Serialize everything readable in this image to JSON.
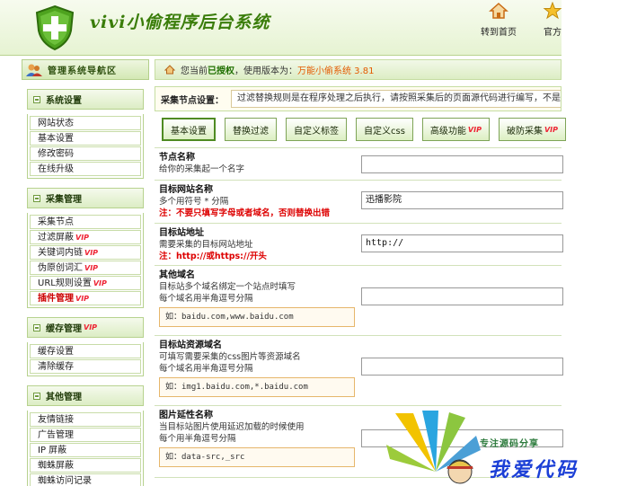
{
  "header": {
    "title": "vivi小偷程序后台系统",
    "nav": [
      {
        "label": "转到首页",
        "icon": "home-icon"
      },
      {
        "label": "官方",
        "icon": "star-icon"
      }
    ]
  },
  "breadcrumb": {
    "prefix": "您当前",
    "authorized": "已授权",
    "mid": "，使用版本为：",
    "version": "万能小偷系统 3.81"
  },
  "sidebar": {
    "title": "管理系统导航区",
    "groups": [
      {
        "title": "系统设置",
        "items": [
          {
            "label": "网站状态"
          },
          {
            "label": "基本设置"
          },
          {
            "label": "修改密码"
          },
          {
            "label": "在线升级"
          }
        ]
      },
      {
        "title": "采集管理",
        "items": [
          {
            "label": "采集节点"
          },
          {
            "label": "过滤屏蔽",
            "vip": "VIP"
          },
          {
            "label": "关键词内链",
            "vip": "VIP"
          },
          {
            "label": "伪原创词汇",
            "vip": "VIP"
          },
          {
            "label": "URL规则设置",
            "vip": "VIP"
          },
          {
            "label": "插件管理",
            "vip": "VIP"
          }
        ]
      },
      {
        "title": "缓存管理",
        "vip": "VIP",
        "items": [
          {
            "label": "缓存设置"
          },
          {
            "label": "清除缓存"
          }
        ]
      },
      {
        "title": "其他管理",
        "items": [
          {
            "label": "友情链接"
          },
          {
            "label": "广告管理"
          },
          {
            "label": "IP 屏蔽"
          },
          {
            "label": "蜘蛛屏蔽"
          },
          {
            "label": "蜘蛛访问记录"
          }
        ]
      }
    ]
  },
  "settings": {
    "label": "采集节点设置：",
    "note": "过滤替换规则是在程序处理之后执行，请按照采集后的页面源代码进行编写，不是"
  },
  "tabs": [
    {
      "label": "基本设置"
    },
    {
      "label": "替换过滤"
    },
    {
      "label": "自定义标签"
    },
    {
      "label": "自定义css"
    },
    {
      "label": "高级功能",
      "vip": "VIP"
    },
    {
      "label": "破防采集",
      "vip": "VIP"
    }
  ],
  "fields": [
    {
      "name": "节点名称",
      "desc": [
        "给你的采集起一个名字"
      ],
      "value": ""
    },
    {
      "name": "目标网站名称",
      "desc": [
        "多个用符号 * 分隔"
      ],
      "warn": "注：不要只填写字母或者域名，否则替换出错",
      "value": "迅播影院"
    },
    {
      "name": "目标站地址",
      "desc": [
        "需要采集的目标网站地址"
      ],
      "warn": "注：http://或https://开头",
      "value": "http://"
    },
    {
      "name": "其他域名",
      "desc": [
        "目标站多个域名绑定一个站点时填写",
        "每个域名用半角逗号分隔"
      ],
      "example": "如：baidu.com,www.baidu.com",
      "value": ""
    },
    {
      "name": "目标站资源域名",
      "desc": [
        "可填写需要采集的css图片等资源域名",
        "每个域名用半角逗号分隔"
      ],
      "example": "如：img1.baidu.com,*.baidu.com",
      "value": ""
    },
    {
      "name": "图片延性名称",
      "desc": [
        "当目标站图片使用延迟加载的时候使用",
        "每个用半角逗号分隔"
      ],
      "example": "如：data-src,_src",
      "value": ""
    }
  ],
  "watermark": {
    "tagline": "专注源码分享",
    "text": "我爱代码"
  }
}
